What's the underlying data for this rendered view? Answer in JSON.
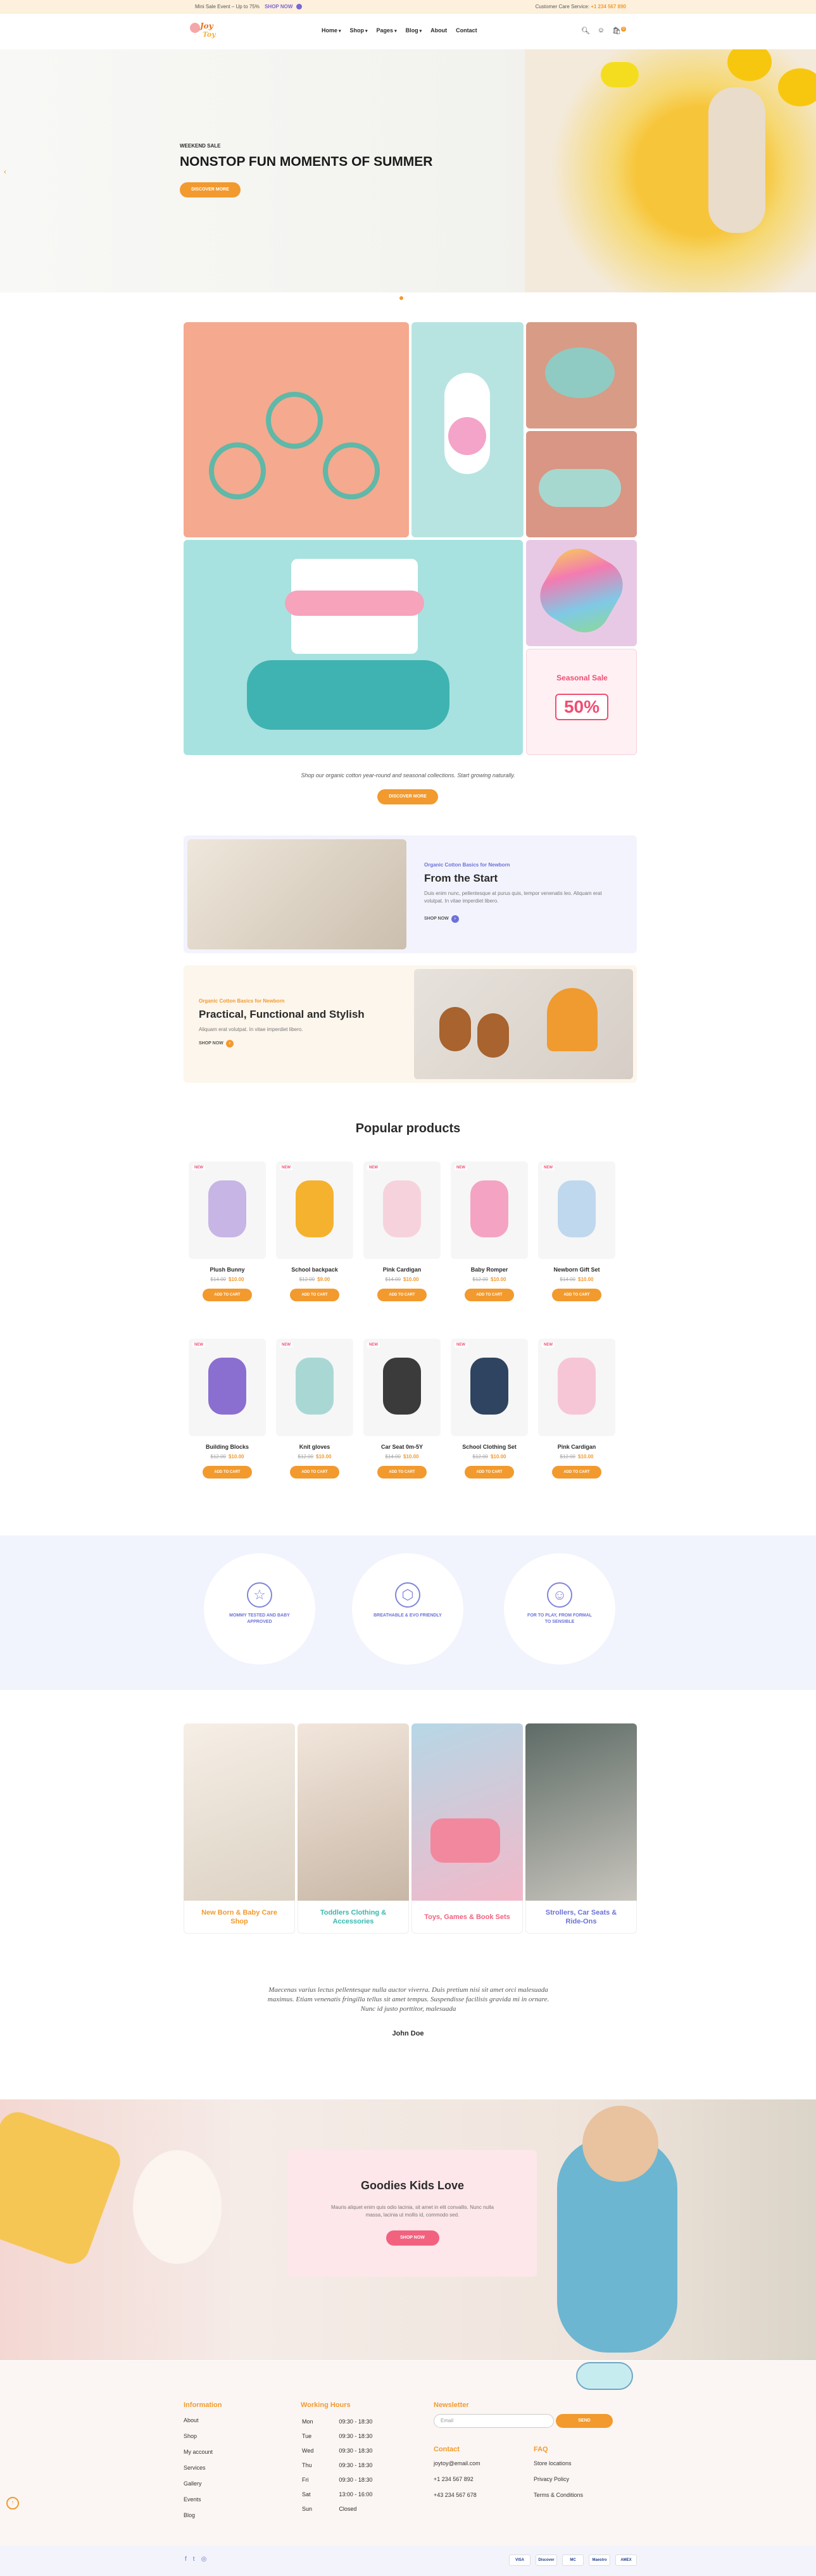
{
  "topbar": {
    "promo": "Mini Sale Event – Up to 75%",
    "promo_link": "SHOP NOW",
    "care": "Customer Care Service:",
    "phone": "+1 234 567 890"
  },
  "header": {
    "logo_line1": "Joy",
    "logo_line2": "Toy",
    "nav": [
      {
        "label": "Home",
        "caret": "▾"
      },
      {
        "label": "Shop",
        "caret": "▾"
      },
      {
        "label": "Pages",
        "caret": "▾"
      },
      {
        "label": "Blog",
        "caret": "▾"
      },
      {
        "label": "About",
        "caret": ""
      },
      {
        "label": "Contact",
        "caret": ""
      }
    ],
    "icons": [
      "search-icon",
      "user-icon",
      "cart-icon"
    ],
    "cart_count": "0"
  },
  "hero": {
    "kicker": "WEEKEND SALE",
    "title": "NONSTOP FUN MOMENTS OF SUMMER",
    "cta": "DISCOVER MORE"
  },
  "grid": {
    "sale_title": "Seasonal Sale",
    "sale_pct": "50%",
    "caption": "Shop our organic cotton year-round and seasonal collections. Start growing naturally.",
    "cta": "DISCOVER MORE"
  },
  "features": [
    {
      "kicker": "Organic Cotton Basics for Newborn",
      "title": "From the Start",
      "text": "Duis enim nunc, pellentesque at purus quis, tempor venenatis leo. Aliquam erat volutpat. In vitae imperdiet libero.",
      "more": "SHOP NOW"
    },
    {
      "kicker": "Organic Cotton Basics for Newborn",
      "title": "Practical, Functional and Stylish",
      "text": "Aliquam erat volutpat. In vitae imperdiet libero.",
      "more": "SHOP NOW"
    }
  ],
  "popular": {
    "title": "Popular products",
    "products": [
      {
        "name": "Plush Bunny",
        "old": "$14.00",
        "price": "$10.00",
        "tag": "NEW",
        "add": "ADD TO CART"
      },
      {
        "name": "School backpack",
        "old": "$12.00",
        "price": "$9.00",
        "tag": "NEW",
        "add": "ADD TO CART"
      },
      {
        "name": "Pink Cardigan",
        "old": "$14.00",
        "price": "$10.00",
        "tag": "NEW",
        "add": "ADD TO CART"
      },
      {
        "name": "Baby Romper",
        "old": "$12.00",
        "price": "$10.00",
        "tag": "NEW",
        "add": "ADD TO CART"
      },
      {
        "name": "Newborn Gift Set",
        "old": "$14.00",
        "price": "$10.00",
        "tag": "NEW",
        "add": "ADD TO CART"
      },
      {
        "name": "Building Blocks",
        "old": "$12.00",
        "price": "$10.00",
        "tag": "NEW",
        "add": "ADD TO CART"
      },
      {
        "name": "Knit gloves",
        "old": "$12.00",
        "price": "$10.00",
        "tag": "NEW",
        "add": "ADD TO CART"
      },
      {
        "name": "Car Seat 0m-5Y",
        "old": "$14.00",
        "price": "$10.00",
        "tag": "NEW",
        "add": "ADD TO CART"
      },
      {
        "name": "School Clothing Set",
        "old": "$12.00",
        "price": "$10.00",
        "tag": "NEW",
        "add": "ADD TO CART"
      },
      {
        "name": "Pink Cardigan",
        "old": "$12.00",
        "price": "$10.00",
        "tag": "NEW",
        "add": "ADD TO CART"
      }
    ]
  },
  "badges": [
    {
      "icon": "☆",
      "text": "MOMMY TESTED AND BABY APPROVED"
    },
    {
      "icon": "⬡",
      "text": "BREATHABLE & EVO FRIENDLY"
    },
    {
      "icon": "☺",
      "text": "FOR TO PLAY, FROM FORMAL TO SENSIBLE"
    }
  ],
  "categories": [
    {
      "label": "New Born & Baby Care Shop",
      "color": "#f29a2e"
    },
    {
      "label": "Toddlers Clothing & Accessories",
      "color": "#3ab7b0"
    },
    {
      "label": "Toys, Games & Book Sets",
      "color": "#f2627f"
    },
    {
      "label": "Strollers, Car Seats & Ride-Ons",
      "color": "#6a72d8"
    }
  ],
  "testimonial": {
    "quote": "Maecenas varius lectus pellentesque nulla auctor viverra. Duis pretium nisi sit amet orci malesuada maximus. Etiam venenatis fringilla tellus sit amet tempus. Suspendisse facilisis gravida mi in ornare. Nunc id justo porttitor, malesuada",
    "name": "John Doe"
  },
  "banner": {
    "title": "Goodies Kids Love",
    "text": "Mauris aliquet enim quis odio lacinia, sit amet in elit convallis. Nunc nulla massa, lacinia ut mollis id, commodo sed.",
    "cta": "SHOP NOW"
  },
  "footer": {
    "info_title": "Information",
    "info_links": [
      "About",
      "Shop",
      "My account",
      "Services",
      "Gallery",
      "Events",
      "Blog"
    ],
    "hours_title": "Working Hours",
    "hours": [
      {
        "day": "Mon",
        "time": "09:30 - 18:30"
      },
      {
        "day": "Tue",
        "time": "09:30 - 18:30"
      },
      {
        "day": "Wed",
        "time": "09:30 - 18:30"
      },
      {
        "day": "Thu",
        "time": "09:30 - 18:30"
      },
      {
        "day": "Fri",
        "time": "09:30 - 18:30"
      },
      {
        "day": "Sat",
        "time": "13:00 - 16:00"
      },
      {
        "day": "Sun",
        "time": "Closed"
      }
    ],
    "newsletter_title": "Newsletter",
    "email_placeholder": "Email",
    "send": "SEND",
    "contact_title": "Contact",
    "contacts": [
      "joytoy@email.com",
      "+1 234 567 892",
      "+43 234 567 678"
    ],
    "faq_title": "FAQ",
    "faq": [
      "Store locations",
      "Privacy Policy",
      "Terms & Conditions"
    ]
  },
  "bottom": {
    "social": [
      "f",
      "t",
      "◎"
    ],
    "payments": [
      "VISA",
      "Discover",
      "MC",
      "Maestro",
      "AMEX"
    ]
  },
  "colors": {
    "accent": "#f29a2e",
    "pink": "#f2627f",
    "purple": "#6a72d8",
    "teal": "#3ab7b0"
  }
}
